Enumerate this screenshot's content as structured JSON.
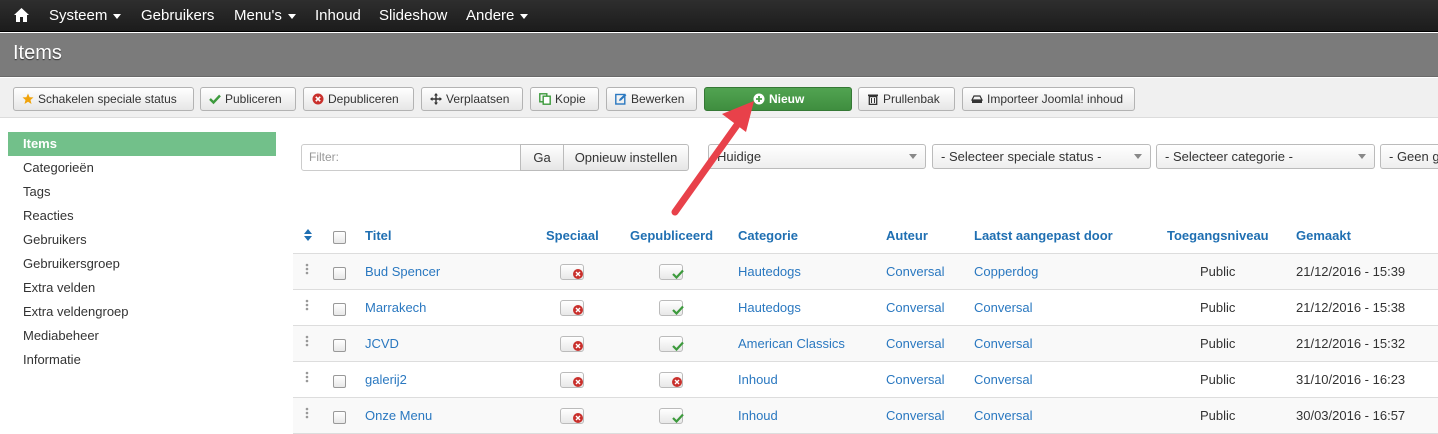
{
  "navbar": {
    "home_icon": "home-icon",
    "items": [
      {
        "label": "Systeem",
        "dropdown": true
      },
      {
        "label": "Gebruikers",
        "dropdown": false
      },
      {
        "label": "Menu's",
        "dropdown": true
      },
      {
        "label": "Inhoud",
        "dropdown": false
      },
      {
        "label": "Slideshow",
        "dropdown": false
      },
      {
        "label": "Andere",
        "dropdown": true
      }
    ]
  },
  "header": {
    "title": "Items"
  },
  "toolbar": {
    "buttons": [
      {
        "label": "Schakelen speciale status",
        "icon": "star-icon",
        "color": "#f0a30a"
      },
      {
        "label": "Publiceren",
        "icon": "check-icon",
        "color": "#3c9a3c"
      },
      {
        "label": "Depubliceren",
        "icon": "unpublish-icon",
        "color": "#c9302c"
      },
      {
        "label": "Verplaatsen",
        "icon": "move-icon",
        "color": "#333333"
      },
      {
        "label": "Kopie",
        "icon": "copy-icon",
        "color": "#3c9a3c"
      },
      {
        "label": "Bewerken",
        "icon": "edit-icon",
        "color": "#2a78c0"
      },
      {
        "label": "Nieuw",
        "icon": "plus-circle-icon",
        "color": "#ffffff"
      },
      {
        "label": "Prullenbak",
        "icon": "trash-icon",
        "color": "#333333"
      },
      {
        "label": "Importeer Joomla! inhoud",
        "icon": "import-icon",
        "color": "#333333"
      }
    ]
  },
  "sidebar": {
    "items": [
      {
        "label": "Items",
        "active": true
      },
      {
        "label": "Categorieën",
        "active": false
      },
      {
        "label": "Tags",
        "active": false
      },
      {
        "label": "Reacties",
        "active": false
      },
      {
        "label": "Gebruikers",
        "active": false
      },
      {
        "label": "Gebruikersgroep",
        "active": false
      },
      {
        "label": "Extra velden",
        "active": false
      },
      {
        "label": "Extra veldengroep",
        "active": false
      },
      {
        "label": "Mediabeheer",
        "active": false
      },
      {
        "label": "Informatie",
        "active": false
      }
    ]
  },
  "filters": {
    "search_placeholder": "Filter:",
    "go_label": "Ga",
    "reset_label": "Opnieuw instellen",
    "selects": [
      "Huidige",
      "- Selecteer speciale status -",
      "- Selecteer categorie -",
      "- Geen g"
    ]
  },
  "table": {
    "headers": {
      "title": "Titel",
      "featured": "Speciaal",
      "published": "Gepubliceerd",
      "category": "Categorie",
      "author": "Auteur",
      "modified_by": "Laatst aangepast door",
      "access": "Toegangsniveau",
      "created": "Gemaakt"
    },
    "rows": [
      {
        "title": "Bud Spencer",
        "featured": false,
        "published": true,
        "category": "Hautedogs",
        "author": "Conversal",
        "modified_by": "Copperdog",
        "access": "Public",
        "created": "21/12/2016 - 15:39"
      },
      {
        "title": "Marrakech",
        "featured": false,
        "published": true,
        "category": "Hautedogs",
        "author": "Conversal",
        "modified_by": "Conversal",
        "access": "Public",
        "created": "21/12/2016 - 15:38"
      },
      {
        "title": "JCVD",
        "featured": false,
        "published": true,
        "category": "American Classics",
        "author": "Conversal",
        "modified_by": "Conversal",
        "access": "Public",
        "created": "21/12/2016 - 15:32"
      },
      {
        "title": "galerij2",
        "featured": false,
        "published": false,
        "category": "Inhoud",
        "author": "Conversal",
        "modified_by": "Conversal",
        "access": "Public",
        "created": "31/10/2016 - 16:23"
      },
      {
        "title": "Onze Menu",
        "featured": false,
        "published": true,
        "category": "Inhoud",
        "author": "Conversal",
        "modified_by": "Conversal",
        "access": "Public",
        "created": "30/03/2016 - 16:57"
      }
    ]
  },
  "colors": {
    "active_sidebar": "#72c08a",
    "link": "#2a78c0",
    "new_button": "#47a047",
    "annotation_arrow": "#e8414a"
  }
}
